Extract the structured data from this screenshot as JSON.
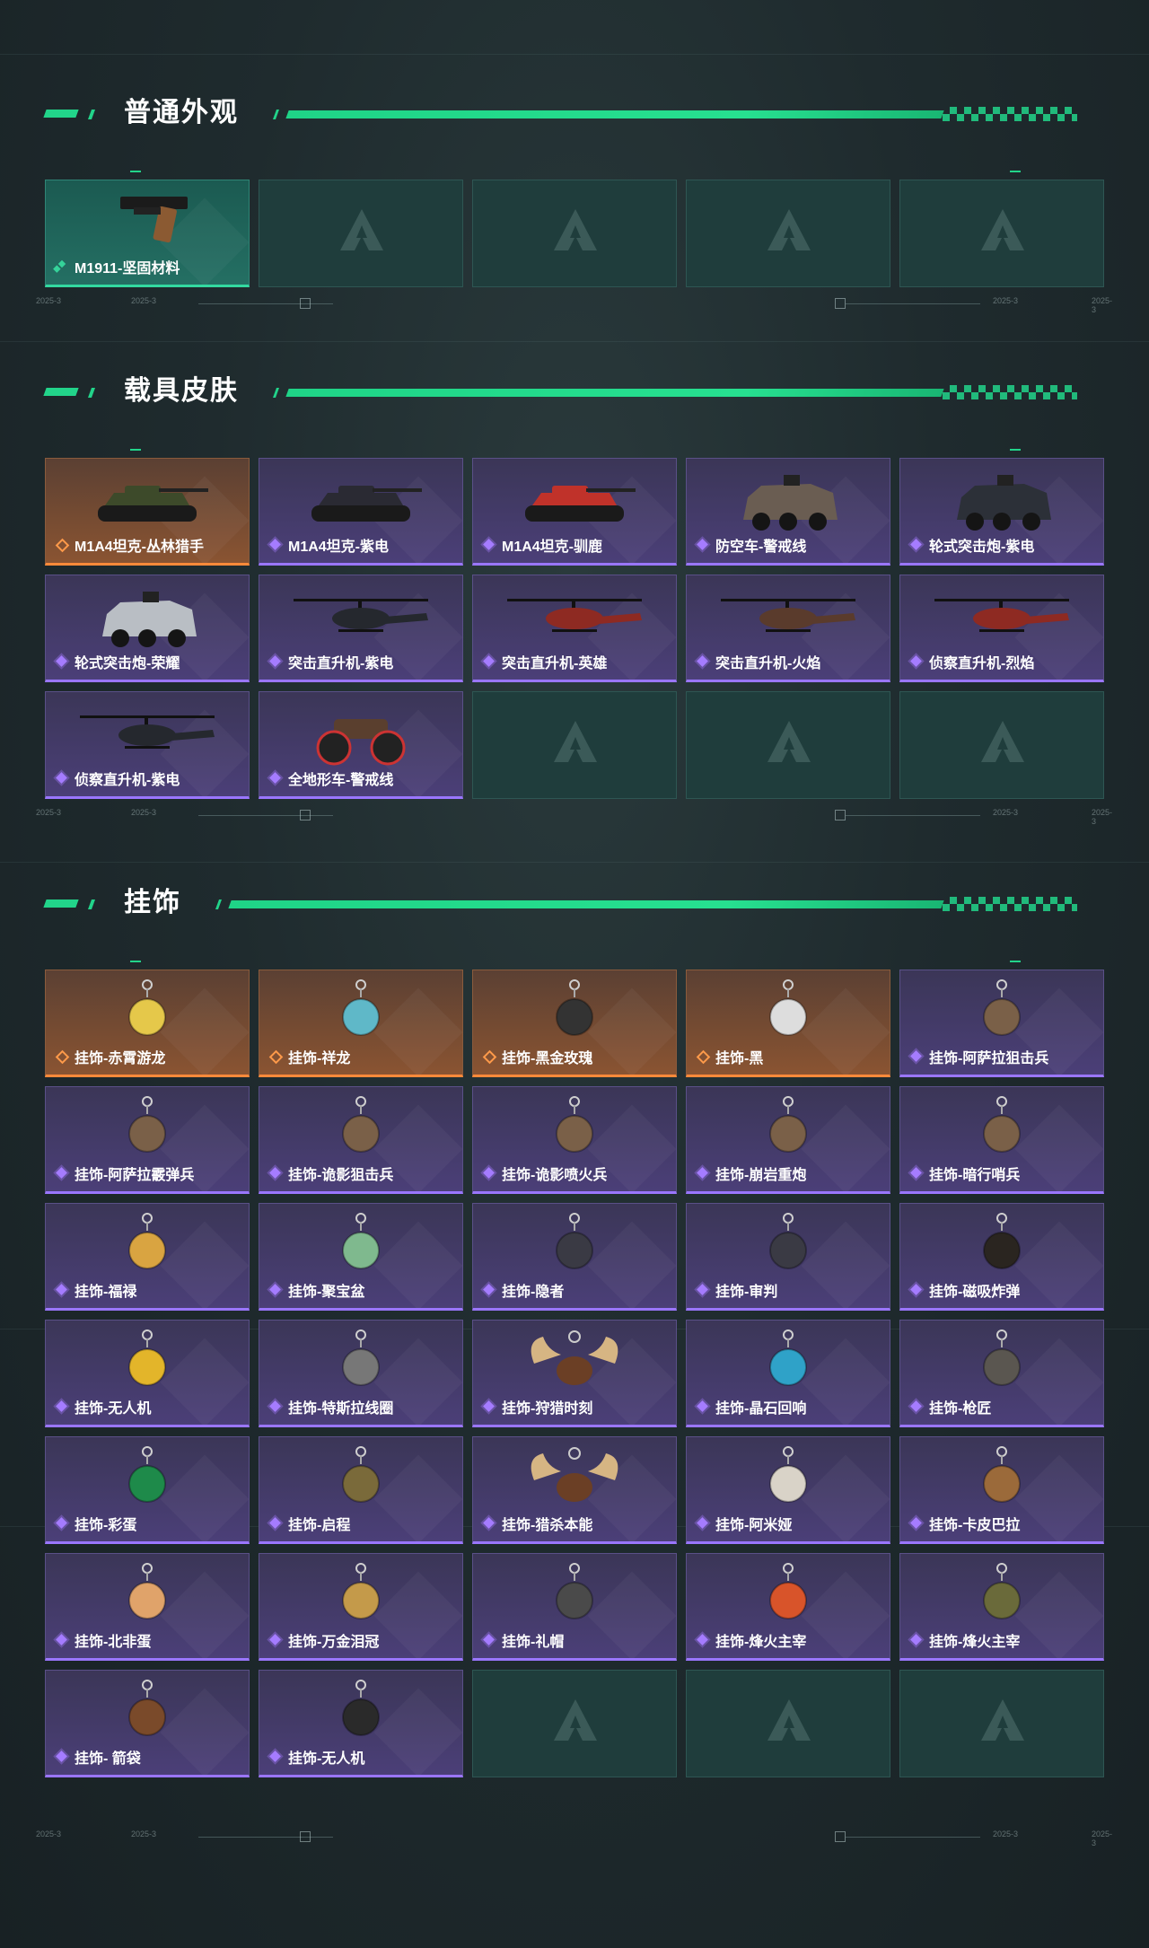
{
  "colors": {
    "accent": "#22d48a",
    "rarity_purple": "#9a76ff",
    "rarity_orange": "#ff8a3a",
    "rarity_green": "#33d9a0"
  },
  "ruler_text": "2025-3",
  "sections": [
    {
      "title": "普通外观",
      "rows": [
        [
          {
            "label": "M1911-坚固材料",
            "rarity": "green",
            "icon": "pistol"
          },
          {
            "empty": true
          },
          {
            "empty": true
          },
          {
            "empty": true
          },
          {
            "empty": true
          }
        ]
      ]
    },
    {
      "title": "载具皮肤",
      "rows": [
        [
          {
            "label": "M1A4坦克-丛林猎手",
            "rarity": "orange",
            "icon": "tank-camo"
          },
          {
            "label": "M1A4坦克-紫电",
            "rarity": "purple",
            "icon": "tank-dark"
          },
          {
            "label": "M1A4坦克-驯鹿",
            "rarity": "purple",
            "icon": "tank-red"
          },
          {
            "label": "防空车-警戒线",
            "rarity": "purple",
            "icon": "apc"
          },
          {
            "label": "轮式突击炮-紫电",
            "rarity": "purple",
            "icon": "armored-car"
          }
        ],
        [
          {
            "label": "轮式突击炮-荣耀",
            "rarity": "purple",
            "icon": "buggy"
          },
          {
            "label": "突击直升机-紫电",
            "rarity": "purple",
            "icon": "helicopter-dark"
          },
          {
            "label": "突击直升机-英雄",
            "rarity": "purple",
            "icon": "helicopter-red"
          },
          {
            "label": "突击直升机-火焰",
            "rarity": "purple",
            "icon": "helicopter-fire"
          },
          {
            "label": "侦察直升机-烈焰",
            "rarity": "purple",
            "icon": "helicopter-scout"
          }
        ],
        [
          {
            "label": "侦察直升机-紫电",
            "rarity": "purple",
            "icon": "helicopter-scout-dark"
          },
          {
            "label": "全地形车-警戒线",
            "rarity": "purple",
            "icon": "atv"
          },
          {
            "empty": true
          },
          {
            "empty": true
          },
          {
            "empty": true
          }
        ]
      ]
    },
    {
      "title": "挂饰",
      "rows": [
        [
          {
            "label": "挂饰-赤霄游龙",
            "rarity": "orange",
            "icon": "charm-dragon"
          },
          {
            "label": "挂饰-祥龙",
            "rarity": "orange",
            "icon": "charm-dragon-blue"
          },
          {
            "label": "挂饰-黑金玫瑰",
            "rarity": "orange",
            "icon": "charm-rose"
          },
          {
            "label": "挂饰-黑",
            "rarity": "orange",
            "icon": "charm-tag"
          },
          {
            "label": "挂饰-阿萨拉狙击兵",
            "rarity": "purple",
            "icon": "charm-figure"
          }
        ],
        [
          {
            "label": "挂饰-阿萨拉霰弹兵",
            "rarity": "purple",
            "icon": "charm-figure"
          },
          {
            "label": "挂饰-诡影狙击兵",
            "rarity": "purple",
            "icon": "charm-figure"
          },
          {
            "label": "挂饰-诡影喷火兵",
            "rarity": "purple",
            "icon": "charm-figure"
          },
          {
            "label": "挂饰-崩岩重炮",
            "rarity": "purple",
            "icon": "charm-figure"
          },
          {
            "label": "挂饰-暗行哨兵",
            "rarity": "purple",
            "icon": "charm-figure"
          }
        ],
        [
          {
            "label": "挂饰-福禄",
            "rarity": "purple",
            "icon": "charm-gourd"
          },
          {
            "label": "挂饰-聚宝盆",
            "rarity": "purple",
            "icon": "charm-bowl"
          },
          {
            "label": "挂饰-隐者",
            "rarity": "purple",
            "icon": "charm-card"
          },
          {
            "label": "挂饰-审判",
            "rarity": "purple",
            "icon": "charm-card"
          },
          {
            "label": "挂饰-磁吸炸弹",
            "rarity": "purple",
            "icon": "charm-bomb"
          }
        ],
        [
          {
            "label": "挂饰-无人机",
            "rarity": "purple",
            "icon": "charm-drone"
          },
          {
            "label": "挂饰-特斯拉线圈",
            "rarity": "purple",
            "icon": "charm-coil"
          },
          {
            "label": "挂饰-狩猎时刻",
            "rarity": "purple",
            "icon": "charm-antlers"
          },
          {
            "label": "挂饰-晶石回响",
            "rarity": "purple",
            "icon": "charm-crystal"
          },
          {
            "label": "挂饰-枪匠",
            "rarity": "purple",
            "icon": "charm-box"
          }
        ],
        [
          {
            "label": "挂饰-彩蛋",
            "rarity": "purple",
            "icon": "charm-egg"
          },
          {
            "label": "挂饰-启程",
            "rarity": "purple",
            "icon": "charm-round"
          },
          {
            "label": "挂饰-猎杀本能",
            "rarity": "purple",
            "icon": "charm-antlers"
          },
          {
            "label": "挂饰-阿米娅",
            "rarity": "purple",
            "icon": "charm-rabbit"
          },
          {
            "label": "挂饰-卡皮巴拉",
            "rarity": "purple",
            "icon": "charm-capybara"
          }
        ],
        [
          {
            "label": "挂饰-北非蛋",
            "rarity": "purple",
            "icon": "charm-egg-dish"
          },
          {
            "label": "挂饰-万金泪冠",
            "rarity": "purple",
            "icon": "charm-burger"
          },
          {
            "label": "挂饰-礼帽",
            "rarity": "purple",
            "icon": "charm-hat"
          },
          {
            "label": "挂饰-烽火主宰",
            "rarity": "purple",
            "icon": "charm-banner"
          },
          {
            "label": "挂饰-烽火主宰",
            "rarity": "purple",
            "icon": "charm-pyramid"
          }
        ],
        [
          {
            "label": "挂饰- 箭袋",
            "rarity": "purple",
            "icon": "charm-quiver"
          },
          {
            "label": "挂饰-无人机",
            "rarity": "purple",
            "icon": "charm-roller"
          },
          {
            "empty": true
          },
          {
            "empty": true
          },
          {
            "empty": true
          }
        ]
      ]
    }
  ]
}
